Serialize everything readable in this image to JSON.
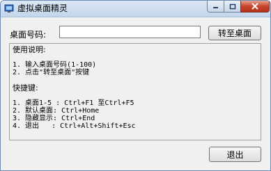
{
  "window": {
    "title": "虚拟桌面精灵",
    "icon": "app-icon"
  },
  "titlebar_buttons": {
    "minimize_icon": "minimize-icon",
    "maximize_icon": "maximize-icon",
    "close_icon": "close-icon"
  },
  "form": {
    "desktop_label": "桌面号码:",
    "desktop_input_value": "",
    "goto_button": "转至桌面"
  },
  "help": {
    "usage_title": "使用说明:",
    "usage_1": "1. 输入桌面号码(1-100)",
    "usage_2": "2. 点击\"转至桌面\"按键",
    "shortcut_title": "快捷键:",
    "shortcut_1": "1. 桌面1-5 : Ctrl+F1 至Ctrl+F5",
    "shortcut_2": "2. 默认桌面: Ctrl+Home",
    "shortcut_3": "3. 隐藏显示: Ctrl+End",
    "shortcut_4": "4. 退出   : Ctrl+Alt+Shift+Esc"
  },
  "footer": {
    "exit_button": "退出"
  },
  "colors": {
    "titlebar": "#c4d6ec",
    "close_button": "#c7452d",
    "client_bg": "#f0f0f0"
  }
}
